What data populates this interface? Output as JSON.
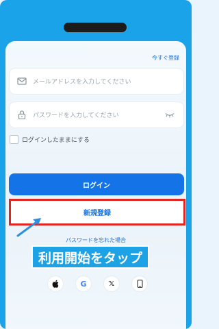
{
  "header": {
    "register_now_link": "今すぐ登録"
  },
  "form": {
    "email_placeholder": "メールアドレスを入力してください",
    "password_placeholder": "パスワードを入力してください",
    "remember_label": "ログインしたままにする",
    "login_button": "ログイン",
    "register_button": "新規登録",
    "forgot_password": "パスワードを忘れた場合"
  },
  "annotation": {
    "callout_text": "利用開始をタップ"
  },
  "social": [
    {
      "icon": "apple-icon"
    },
    {
      "icon": "google-icon",
      "glyph": "G"
    },
    {
      "icon": "x-icon",
      "glyph": "𝕏"
    },
    {
      "icon": "phone-icon"
    }
  ],
  "colors": {
    "frame": "#1aa3e8",
    "primary_button": "#1473e6",
    "highlight_border": "#e0261f",
    "callout_bg": "#1ea2e6"
  }
}
